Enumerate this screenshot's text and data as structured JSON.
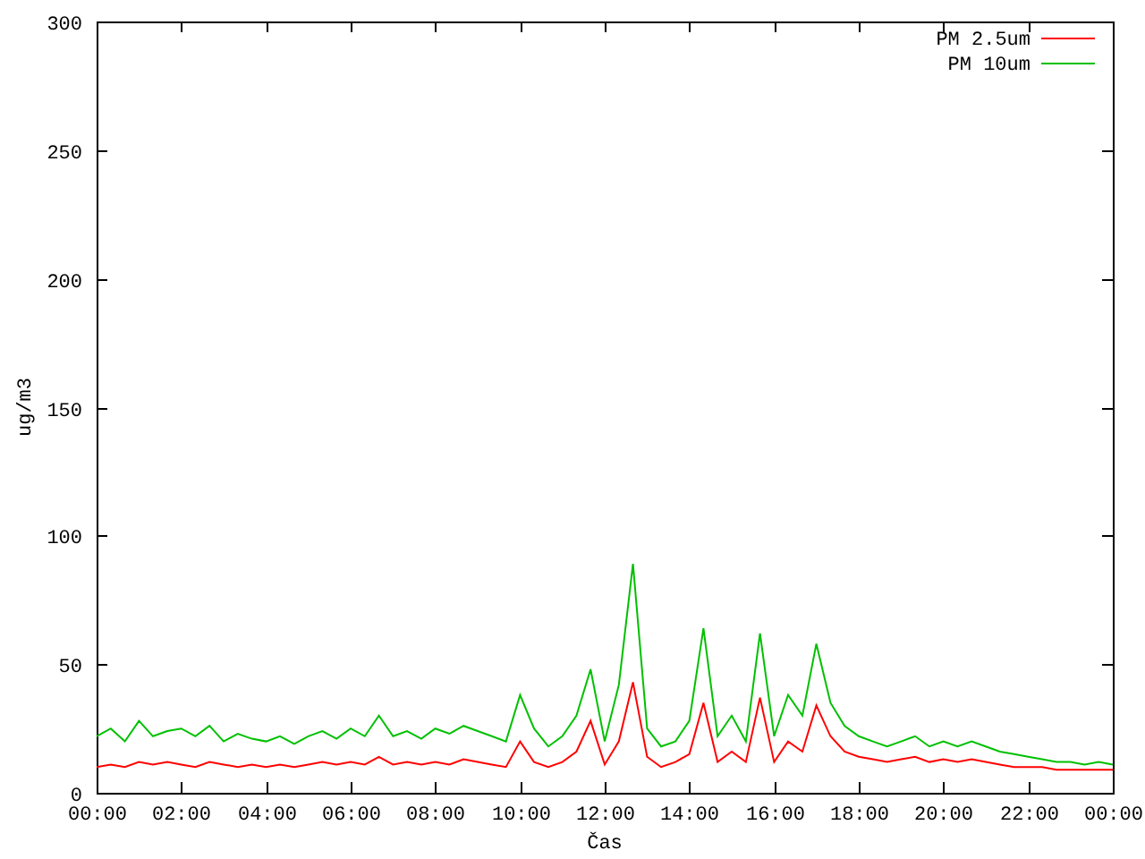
{
  "chart_data": {
    "type": "line",
    "xlabel": "Čas",
    "ylabel": "ug/m3",
    "x": [
      0,
      0.333,
      0.667,
      1,
      1.333,
      1.667,
      2,
      2.333,
      2.667,
      3,
      3.333,
      3.667,
      4,
      4.333,
      4.667,
      5,
      5.333,
      5.667,
      6,
      6.333,
      6.667,
      7,
      7.333,
      7.667,
      8,
      8.333,
      8.667,
      9,
      9.333,
      9.667,
      10,
      10.333,
      10.667,
      11,
      11.333,
      11.667,
      12,
      12.333,
      12.667,
      13,
      13.333,
      13.667,
      14,
      14.333,
      14.667,
      15,
      15.333,
      15.667,
      16,
      16.333,
      16.667,
      17,
      17.333,
      17.667,
      18,
      18.333,
      18.667,
      19,
      19.333,
      19.667,
      20,
      20.333,
      20.667,
      21,
      21.333,
      21.667,
      22,
      22.333,
      22.667,
      23,
      23.333,
      23.667,
      24
    ],
    "series": [
      {
        "name": "PM 2.5um",
        "color": "#ff0000",
        "values": [
          10,
          11,
          10,
          12,
          11,
          12,
          11,
          10,
          12,
          11,
          10,
          11,
          10,
          11,
          10,
          11,
          12,
          11,
          12,
          11,
          14,
          11,
          12,
          11,
          12,
          11,
          13,
          12,
          11,
          10,
          20,
          12,
          10,
          12,
          16,
          28,
          11,
          20,
          43,
          14,
          10,
          12,
          15,
          35,
          12,
          16,
          12,
          37,
          12,
          20,
          16,
          34,
          22,
          16,
          14,
          13,
          12,
          13,
          14,
          12,
          13,
          12,
          13,
          12,
          11,
          10,
          10,
          10,
          9,
          9,
          9,
          9,
          9
        ]
      },
      {
        "name": "PM 10um",
        "color": "#00c000",
        "values": [
          22,
          25,
          20,
          28,
          22,
          24,
          25,
          22,
          26,
          20,
          23,
          21,
          20,
          22,
          19,
          22,
          24,
          21,
          25,
          22,
          30,
          22,
          24,
          21,
          25,
          23,
          26,
          24,
          22,
          20,
          38,
          25,
          18,
          22,
          30,
          48,
          20,
          42,
          89,
          25,
          18,
          20,
          28,
          64,
          22,
          30,
          20,
          62,
          22,
          38,
          30,
          58,
          35,
          26,
          22,
          20,
          18,
          20,
          22,
          18,
          20,
          18,
          20,
          18,
          16,
          15,
          14,
          13,
          12,
          12,
          11,
          12,
          11
        ]
      }
    ],
    "xlim": [
      0,
      24
    ],
    "ylim": [
      0,
      300
    ],
    "xticks": [
      {
        "value": 0,
        "label": "00:00"
      },
      {
        "value": 2,
        "label": "02:00"
      },
      {
        "value": 4,
        "label": "04:00"
      },
      {
        "value": 6,
        "label": "06:00"
      },
      {
        "value": 8,
        "label": "08:00"
      },
      {
        "value": 10,
        "label": "10:00"
      },
      {
        "value": 12,
        "label": "12:00"
      },
      {
        "value": 14,
        "label": "14:00"
      },
      {
        "value": 16,
        "label": "16:00"
      },
      {
        "value": 18,
        "label": "18:00"
      },
      {
        "value": 20,
        "label": "20:00"
      },
      {
        "value": 22,
        "label": "22:00"
      },
      {
        "value": 24,
        "label": "00:00"
      }
    ],
    "yticks": [
      0,
      50,
      100,
      150,
      200,
      250,
      300
    ],
    "legend": true
  }
}
